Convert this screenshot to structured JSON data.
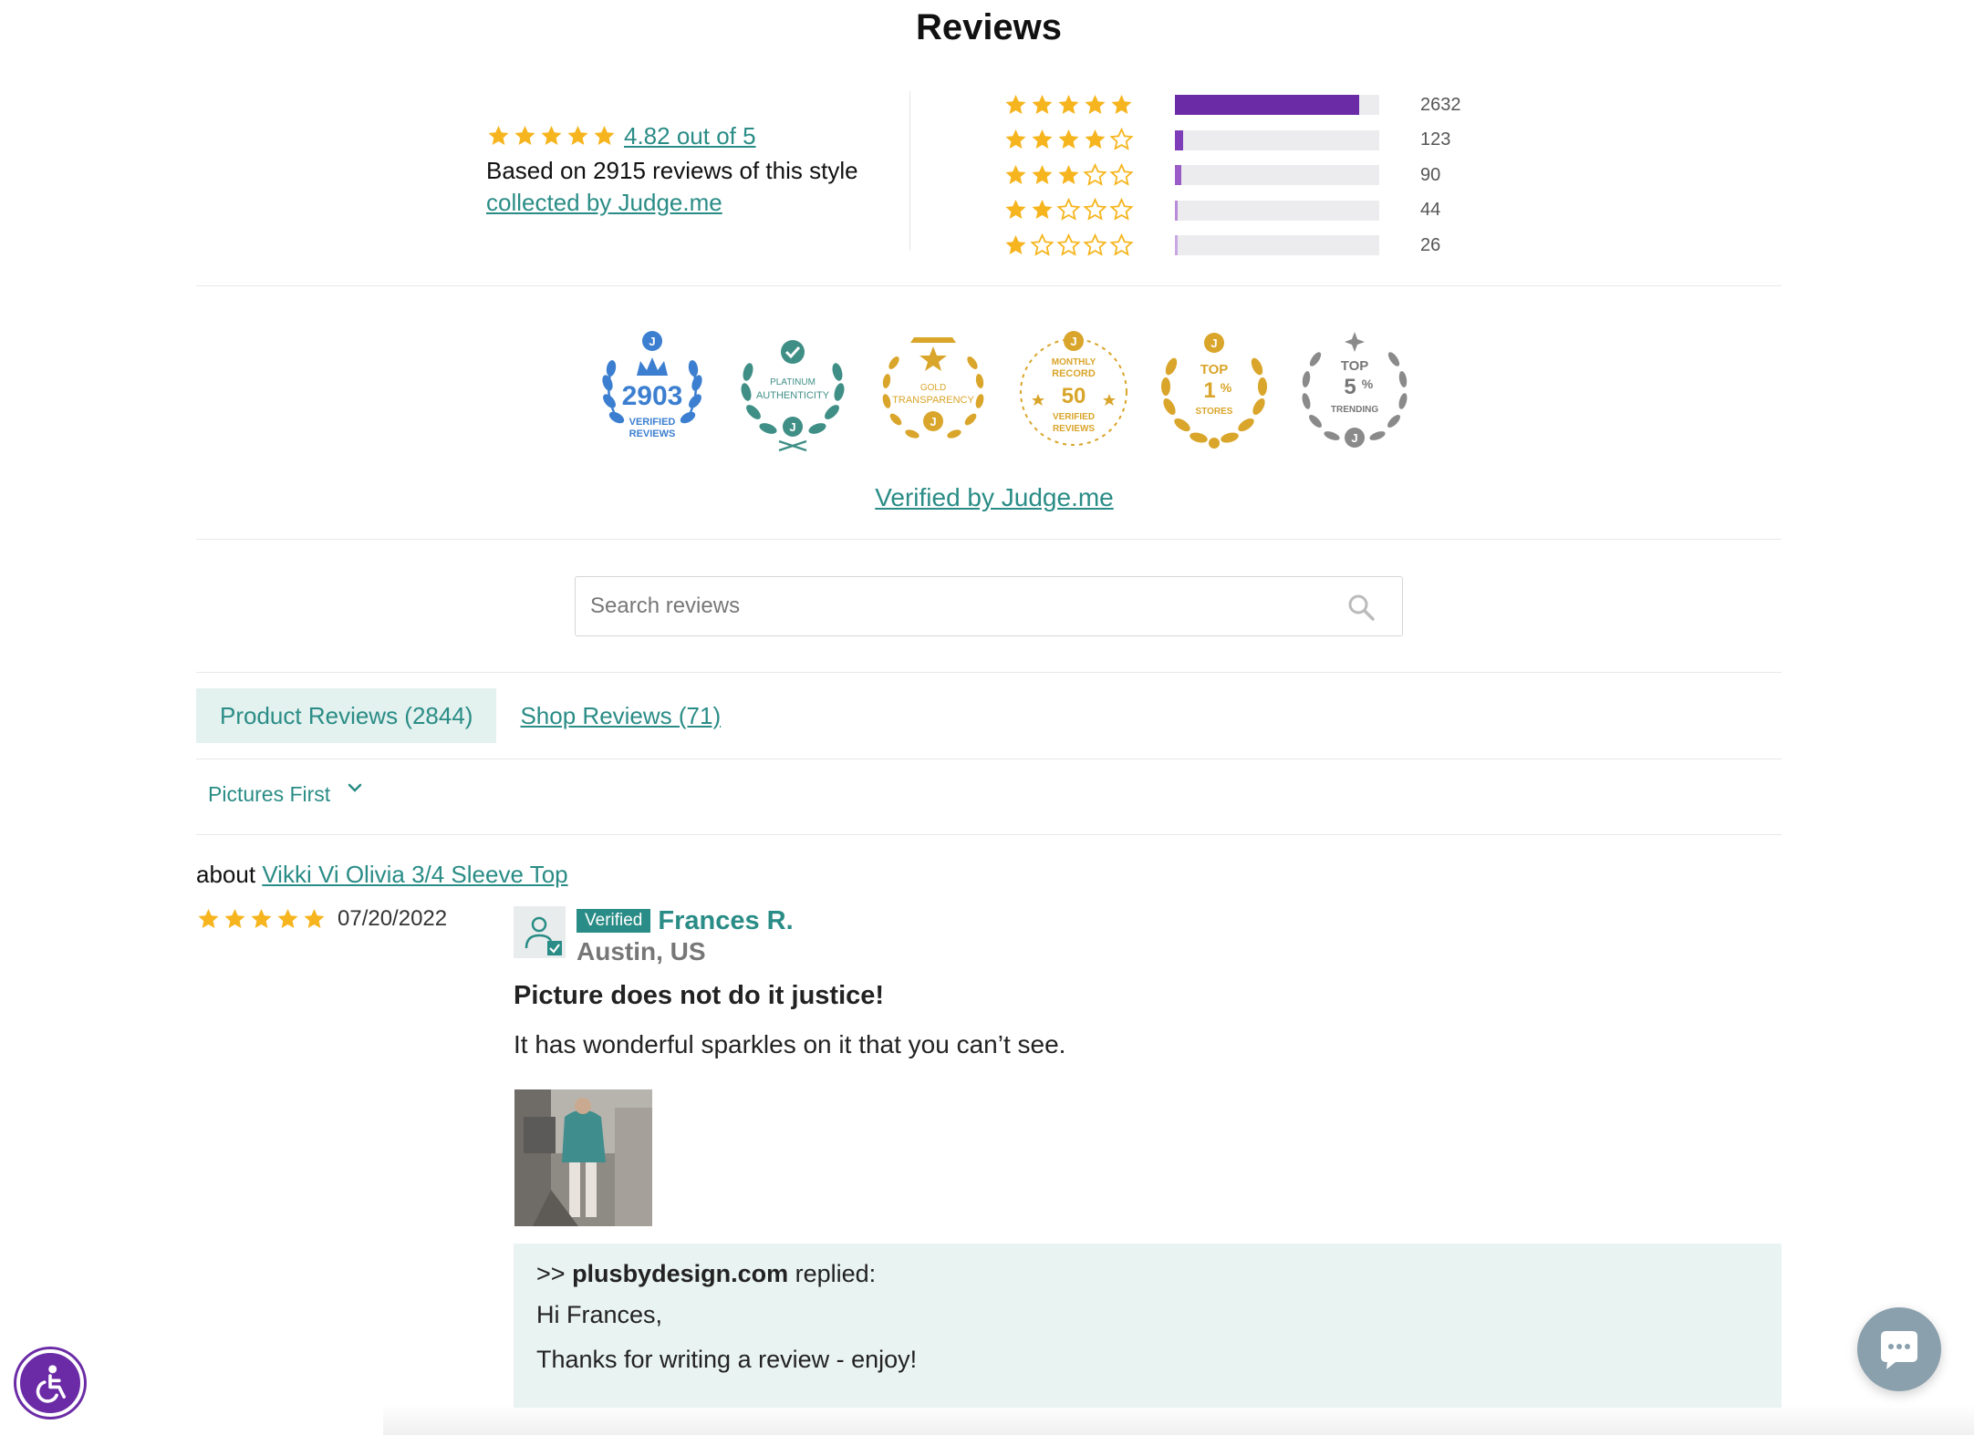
{
  "header": {
    "title": "Reviews"
  },
  "summary": {
    "average_link": "4.82 out of 5",
    "average_rating": 4.82,
    "average_stars": 5,
    "based_on": "Based on 2915 reviews of this style",
    "collected_link": "collected by Judge.me"
  },
  "histogram": [
    {
      "stars": 5,
      "count": "2632",
      "fraction": 0.9,
      "color": "#6b2ba6"
    },
    {
      "stars": 4,
      "count": "123",
      "fraction": 0.04,
      "color": "#7f3cb8"
    },
    {
      "stars": 3,
      "count": "90",
      "fraction": 0.03,
      "color": "#9b5cc8"
    },
    {
      "stars": 2,
      "count": "44",
      "fraction": 0.015,
      "color": "#b98bd8"
    },
    {
      "stars": 1,
      "count": "26",
      "fraction": 0.009,
      "color": "#c9a7e3"
    }
  ],
  "badges": [
    {
      "icon": "verified-reviews-badge-icon",
      "number": "2903",
      "line1": "VERIFIED",
      "line2": "REVIEWS",
      "color": "#3c7fd0"
    },
    {
      "icon": "platinum-authenticity-badge-icon",
      "line1": "PLATINUM",
      "line2": "AUTHENTICITY",
      "color": "#3f8f86"
    },
    {
      "icon": "gold-transparency-badge-icon",
      "line1": "GOLD",
      "line2": "TRANSPARENCY",
      "color": "#d9a52a"
    },
    {
      "icon": "monthly-record-badge-icon",
      "top1": "MONTHLY",
      "top2": "RECORD",
      "number": "50",
      "line1": "VERIFIED",
      "line2": "REVIEWS",
      "color": "#d9a52a"
    },
    {
      "icon": "top-stores-badge-icon",
      "top1": "TOP",
      "number": "1",
      "unit": "%",
      "line1": "STORES",
      "color": "#d9a52a"
    },
    {
      "icon": "top-trending-badge-icon",
      "top1": "TOP",
      "number": "5",
      "unit": "%",
      "line1": "TRENDING",
      "color": "#8a8a8a"
    }
  ],
  "verified_link": "Verified by Judge.me",
  "search": {
    "placeholder": "Search reviews",
    "icon": "search-icon"
  },
  "tabs": {
    "product": "Product Reviews (2844)",
    "shop": "Shop Reviews (71)"
  },
  "sort": {
    "label": "Pictures First",
    "icon": "chevron-down-icon"
  },
  "review": {
    "about_prefix": "about",
    "product_link": "Vikki Vi Olivia 3/4 Sleeve Top",
    "stars": 5,
    "date": "07/20/2022",
    "verified_label": "Verified",
    "name": "Frances R.",
    "location": "Austin, US",
    "title": "Picture does not do it justice!",
    "body": "It has wonderful sparkles on it that you can’t see.",
    "reply": {
      "prefix": ">>",
      "shop": "plusbydesign.com",
      "suffix": "replied:",
      "greeting": "Hi Frances,",
      "message": "Thanks for writing a review - enjoy!"
    }
  },
  "colors": {
    "accent": "#2a8c86",
    "star": "#f6b51e",
    "brand": "#6b2ba6"
  }
}
